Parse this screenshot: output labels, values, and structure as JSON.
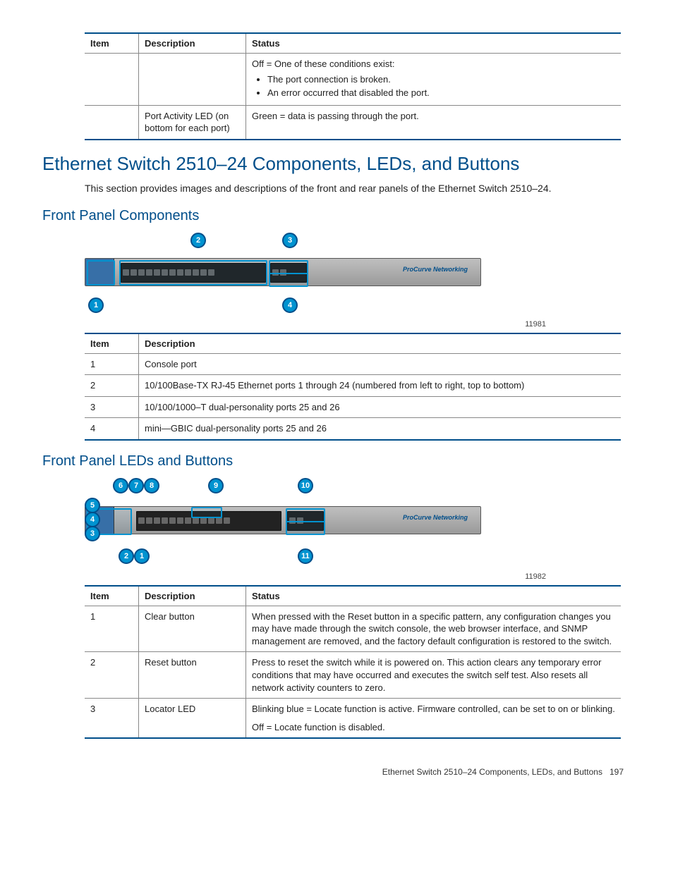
{
  "table1": {
    "headers": [
      "Item",
      "Description",
      "Status"
    ],
    "rows": [
      {
        "item": "",
        "desc": "",
        "status_lead": "Off = One of these conditions exist:",
        "status_bullets": [
          "The port connection is broken.",
          "An error occurred that disabled the port."
        ]
      },
      {
        "item": "",
        "desc": "Port Activity LED (on bottom for each port)",
        "status_lead": "Green = data is passing through the port.",
        "status_bullets": []
      }
    ]
  },
  "section": {
    "title": "Ethernet Switch 2510–24 Components, LEDs, and Buttons",
    "intro": "This section provides images and descriptions of the front and rear panels of the Ethernet Switch 2510–24."
  },
  "sub1": {
    "title": "Front Panel Components",
    "fig_brand": "ProCurve Networking",
    "fig_no": "11981",
    "callouts": [
      "1",
      "2",
      "3",
      "4"
    ],
    "table": {
      "headers": [
        "Item",
        "Description"
      ],
      "rows": [
        {
          "item": "1",
          "desc": "Console port"
        },
        {
          "item": "2",
          "desc": "10/100Base-TX RJ-45 Ethernet ports 1 through 24 (numbered from left to right, top to bottom)"
        },
        {
          "item": "3",
          "desc": "10/100/1000–T dual-personality ports 25 and 26"
        },
        {
          "item": "4",
          "desc": "mini—GBIC dual-personality ports 25 and 26"
        }
      ]
    }
  },
  "sub2": {
    "title": "Front Panel LEDs and Buttons",
    "fig_brand": "ProCurve Networking",
    "fig_no": "11982",
    "callouts": [
      "1",
      "2",
      "3",
      "4",
      "5",
      "6",
      "7",
      "8",
      "9",
      "10",
      "11"
    ],
    "table": {
      "headers": [
        "Item",
        "Description",
        "Status"
      ],
      "rows": [
        {
          "item": "1",
          "desc": "Clear button",
          "status": "When pressed with the Reset button in a specific pattern, any configuration changes you may have made through the switch console, the web browser interface, and SNMP management are removed, and the factory default configuration is restored to the switch."
        },
        {
          "item": "2",
          "desc": "Reset button",
          "status": "Press to reset the switch while it is powered on. This action clears any temporary error conditions that may have occurred and executes the switch self test. Also resets all network activity counters to zero."
        },
        {
          "item": "3",
          "desc": "Locator LED",
          "status_line1": "Blinking blue = Locate function is active. Firmware controlled, can be set to on or blinking.",
          "status_line2": "Off = Locate function is disabled."
        }
      ]
    }
  },
  "footer": {
    "text": "Ethernet Switch 2510–24 Components, LEDs, and Buttons",
    "page": "197"
  }
}
